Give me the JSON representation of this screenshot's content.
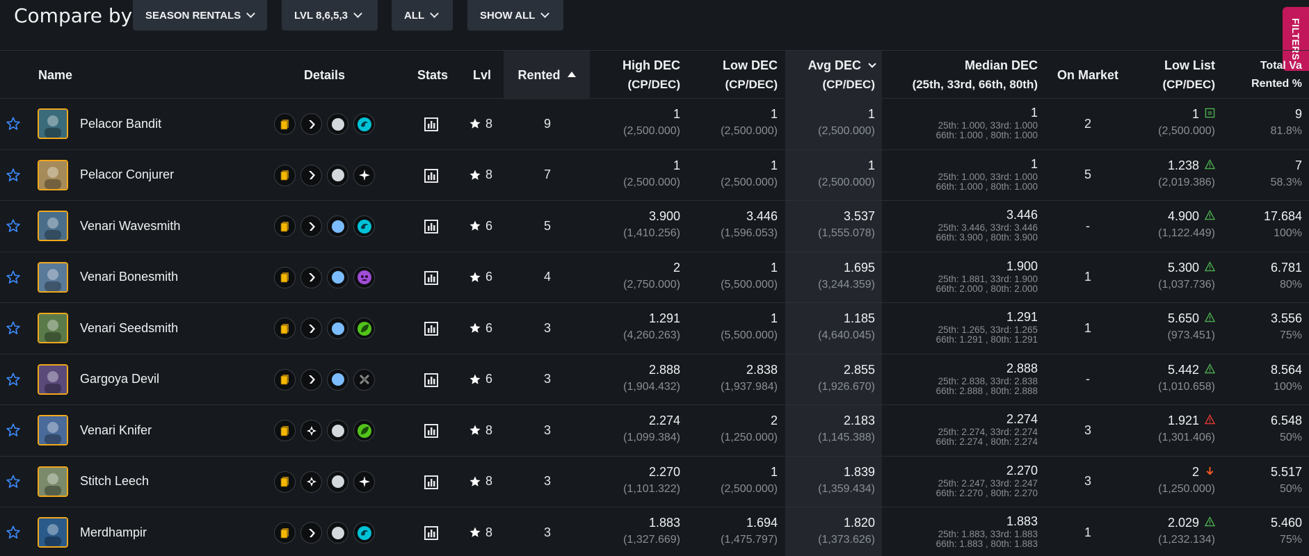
{
  "toolbar": {
    "compare_label": "Compare by",
    "season": "SEASON RENTALS",
    "level": "LVL 8,6,5,3",
    "all": "ALL",
    "show_all": "SHOW ALL",
    "filters": "FILTERS"
  },
  "columns": {
    "name": "Name",
    "details": "Details",
    "stats": "Stats",
    "lvl": "Lvl",
    "rented": "Rented",
    "high_dec": "High DEC",
    "high_dec_sub": "(CP/DEC)",
    "low_dec": "Low DEC",
    "low_dec_sub": "(CP/DEC)",
    "avg_dec": "Avg DEC",
    "avg_dec_sub": "(CP/DEC)",
    "median_dec": "Median DEC",
    "median_dec_sub": "(25th, 33rd, 66th, 80th)",
    "on_market": "On Market",
    "low_list": "Low List",
    "low_list_sub": "(CP/DEC)",
    "total_val": "Total Va",
    "total_val_sub": "Rented %"
  },
  "colors": {
    "accent_filters": "#c2185b",
    "avatar_border": "#f0a81c",
    "warn_green": "#4caf50",
    "warn_red": "#e53935",
    "down_red": "#ff5722",
    "star_blue": "#3d8bfd"
  },
  "rows": [
    {
      "name": "Pelacor Bandit",
      "icons": [
        "card-gold-icon",
        "attack-melee-icon",
        "rarity-common-icon",
        "water-element-icon"
      ],
      "lvl": "8",
      "rented": "9",
      "high": "1",
      "high_sub": "(2,500.000)",
      "low": "1",
      "low_sub": "(2,500.000)",
      "avg": "1",
      "avg_sub": "(2,500.000)",
      "median": "1",
      "median_q1": "25th: 1.000, 33rd: 1.000",
      "median_q2": "66th: 1.000 , 80th: 1.000",
      "on_market": "2",
      "low_list": "1",
      "low_list_icon": "equal",
      "low_list_sub": "(2,500.000)",
      "total": "9",
      "total_sub": "81.8%"
    },
    {
      "name": "Pelacor Conjurer",
      "icons": [
        "card-gold-icon",
        "attack-melee-icon",
        "rarity-common-icon",
        "life-element-icon"
      ],
      "lvl": "8",
      "rented": "7",
      "high": "1",
      "high_sub": "(2,500.000)",
      "low": "1",
      "low_sub": "(2,500.000)",
      "avg": "1",
      "avg_sub": "(2,500.000)",
      "median": "1",
      "median_q1": "25th: 1.000, 33rd: 1.000",
      "median_q2": "66th: 1.000 , 80th: 1.000",
      "on_market": "5",
      "low_list": "1.238",
      "low_list_icon": "warn-green",
      "low_list_sub": "(2,019.386)",
      "total": "7",
      "total_sub": "58.3%"
    },
    {
      "name": "Venari Wavesmith",
      "icons": [
        "card-gold-icon",
        "attack-melee-icon",
        "rarity-rare-icon",
        "water-element-icon"
      ],
      "lvl": "6",
      "rented": "5",
      "high": "3.900",
      "high_sub": "(1,410.256)",
      "low": "3.446",
      "low_sub": "(1,596.053)",
      "avg": "3.537",
      "avg_sub": "(1,555.078)",
      "median": "3.446",
      "median_q1": "25th: 3.446, 33rd: 3.446",
      "median_q2": "66th: 3.900 , 80th: 3.900",
      "on_market": "-",
      "low_list": "4.900",
      "low_list_icon": "warn-green",
      "low_list_sub": "(1,122.449)",
      "total": "17.684",
      "total_sub": "100%"
    },
    {
      "name": "Venari Bonesmith",
      "icons": [
        "card-gold-icon",
        "attack-melee-icon",
        "rarity-rare-icon",
        "death-element-icon"
      ],
      "lvl": "6",
      "rented": "4",
      "high": "2",
      "high_sub": "(2,750.000)",
      "low": "1",
      "low_sub": "(5,500.000)",
      "avg": "1.695",
      "avg_sub": "(3,244.359)",
      "median": "1.900",
      "median_q1": "25th: 1.881, 33rd: 1.900",
      "median_q2": "66th: 2.000 , 80th: 2.000",
      "on_market": "1",
      "low_list": "5.300",
      "low_list_icon": "warn-green",
      "low_list_sub": "(1,037.736)",
      "total": "6.781",
      "total_sub": "80%"
    },
    {
      "name": "Venari Seedsmith",
      "icons": [
        "card-gold-icon",
        "attack-melee-icon",
        "rarity-rare-icon",
        "earth-element-icon"
      ],
      "lvl": "6",
      "rented": "3",
      "high": "1.291",
      "high_sub": "(4,260.263)",
      "low": "1",
      "low_sub": "(5,500.000)",
      "avg": "1.185",
      "avg_sub": "(4,640.045)",
      "median": "1.291",
      "median_q1": "25th: 1.265, 33rd: 1.265",
      "median_q2": "66th: 1.291 , 80th: 1.291",
      "on_market": "1",
      "low_list": "5.650",
      "low_list_icon": "warn-green",
      "low_list_sub": "(973.451)",
      "total": "3.556",
      "total_sub": "75%"
    },
    {
      "name": "Gargoya Devil",
      "icons": [
        "card-gold-icon",
        "attack-melee-icon",
        "rarity-rare-icon",
        "neutral-element-icon"
      ],
      "lvl": "6",
      "rented": "3",
      "high": "2.888",
      "high_sub": "(1,904.432)",
      "low": "2.838",
      "low_sub": "(1,937.984)",
      "avg": "2.855",
      "avg_sub": "(1,926.670)",
      "median": "2.888",
      "median_q1": "25th: 2.838, 33rd: 2.838",
      "median_q2": "66th: 2.888 , 80th: 2.888",
      "on_market": "-",
      "low_list": "5.442",
      "low_list_icon": "warn-green",
      "low_list_sub": "(1,010.658)",
      "total": "8.564",
      "total_sub": "100%"
    },
    {
      "name": "Venari Knifer",
      "icons": [
        "card-gold-icon",
        "attack-ranged-icon",
        "rarity-common-icon",
        "earth-element-icon"
      ],
      "lvl": "8",
      "rented": "3",
      "high": "2.274",
      "high_sub": "(1,099.384)",
      "low": "2",
      "low_sub": "(1,250.000)",
      "avg": "2.183",
      "avg_sub": "(1,145.388)",
      "median": "2.274",
      "median_q1": "25th: 2.274, 33rd: 2.274",
      "median_q2": "66th: 2.274 , 80th: 2.274",
      "on_market": "3",
      "low_list": "1.921",
      "low_list_icon": "warn-red",
      "low_list_sub": "(1,301.406)",
      "total": "6.548",
      "total_sub": "50%"
    },
    {
      "name": "Stitch Leech",
      "icons": [
        "card-gold-icon",
        "attack-ranged-icon",
        "rarity-common-icon",
        "life-element-icon"
      ],
      "lvl": "8",
      "rented": "3",
      "high": "2.270",
      "high_sub": "(1,101.322)",
      "low": "1",
      "low_sub": "(2,500.000)",
      "avg": "1.839",
      "avg_sub": "(1,359.434)",
      "median": "2.270",
      "median_q1": "25th: 2.247, 33rd: 2.247",
      "median_q2": "66th: 2.270 , 80th: 2.270",
      "on_market": "3",
      "low_list": "2",
      "low_list_icon": "down",
      "low_list_sub": "(1,250.000)",
      "total": "5.517",
      "total_sub": "50%"
    },
    {
      "name": "Merdhampir",
      "icons": [
        "card-gold-icon",
        "attack-melee-icon",
        "rarity-common-icon",
        "water-element-icon"
      ],
      "lvl": "8",
      "rented": "3",
      "high": "1.883",
      "high_sub": "(1,327.669)",
      "low": "1.694",
      "low_sub": "(1,475.797)",
      "avg": "1.820",
      "avg_sub": "(1,373.626)",
      "median": "1.883",
      "median_q1": "25th: 1.883, 33rd: 1.883",
      "median_q2": "66th: 1.883 , 80th: 1.883",
      "on_market": "1",
      "low_list": "2.029",
      "low_list_icon": "warn-green",
      "low_list_sub": "(1,232.134)",
      "total": "5.460",
      "total_sub": "75%"
    }
  ]
}
